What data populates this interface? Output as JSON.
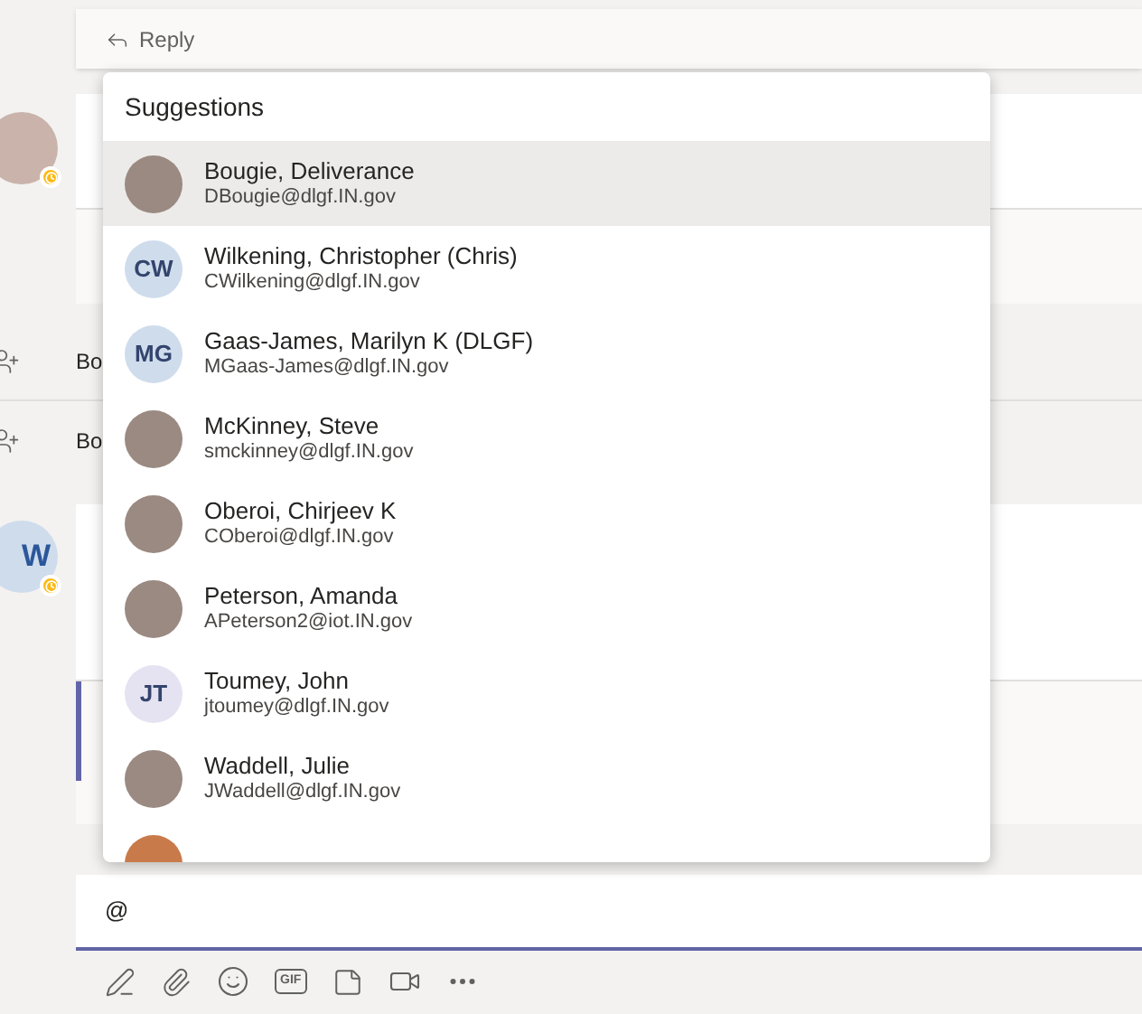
{
  "reply_bar": {
    "label": "Reply"
  },
  "thread": {
    "first_avatar": {
      "kind": "photo",
      "away": true
    },
    "activity_rows": [
      {
        "text": "Bo"
      },
      {
        "text": "Bo"
      }
    ],
    "second_avatar": {
      "kind": "initials",
      "initials": "W",
      "away": true
    }
  },
  "suggestions": {
    "title": "Suggestions",
    "people": [
      {
        "name": "Bougie, Deliverance",
        "email": "DBougie@dlgf.IN.gov",
        "avatar": {
          "kind": "photo"
        },
        "selected": true
      },
      {
        "name": "Wilkening, Christopher (Chris)",
        "email": "CWilkening@dlgf.IN.gov",
        "avatar": {
          "kind": "initials",
          "initials": "CW",
          "color": "#cfdcec"
        },
        "selected": false
      },
      {
        "name": "Gaas-James, Marilyn K (DLGF)",
        "email": "MGaas-James@dlgf.IN.gov",
        "avatar": {
          "kind": "initials",
          "initials": "MG",
          "color": "#cfdcec"
        },
        "selected": false
      },
      {
        "name": "McKinney, Steve",
        "email": "smckinney@dlgf.IN.gov",
        "avatar": {
          "kind": "photo"
        },
        "selected": false
      },
      {
        "name": "Oberoi, Chirjeev K",
        "email": "COberoi@dlgf.IN.gov",
        "avatar": {
          "kind": "photo"
        },
        "selected": false
      },
      {
        "name": "Peterson, Amanda",
        "email": "APeterson2@iot.IN.gov",
        "avatar": {
          "kind": "photo"
        },
        "selected": false
      },
      {
        "name": "Toumey, John",
        "email": "jtoumey@dlgf.IN.gov",
        "avatar": {
          "kind": "initials",
          "initials": "JT",
          "color": "#e5e3f1"
        },
        "selected": false
      },
      {
        "name": "Waddell, Julie",
        "email": "JWaddell@dlgf.IN.gov",
        "avatar": {
          "kind": "photo"
        },
        "selected": false
      }
    ]
  },
  "compose": {
    "value": "@"
  },
  "toolbar": [
    {
      "kind": "format"
    },
    {
      "kind": "attach"
    },
    {
      "kind": "emoji"
    },
    {
      "kind": "gif",
      "label": "GIF"
    },
    {
      "kind": "sticker"
    },
    {
      "kind": "meet"
    },
    {
      "kind": "more"
    }
  ]
}
